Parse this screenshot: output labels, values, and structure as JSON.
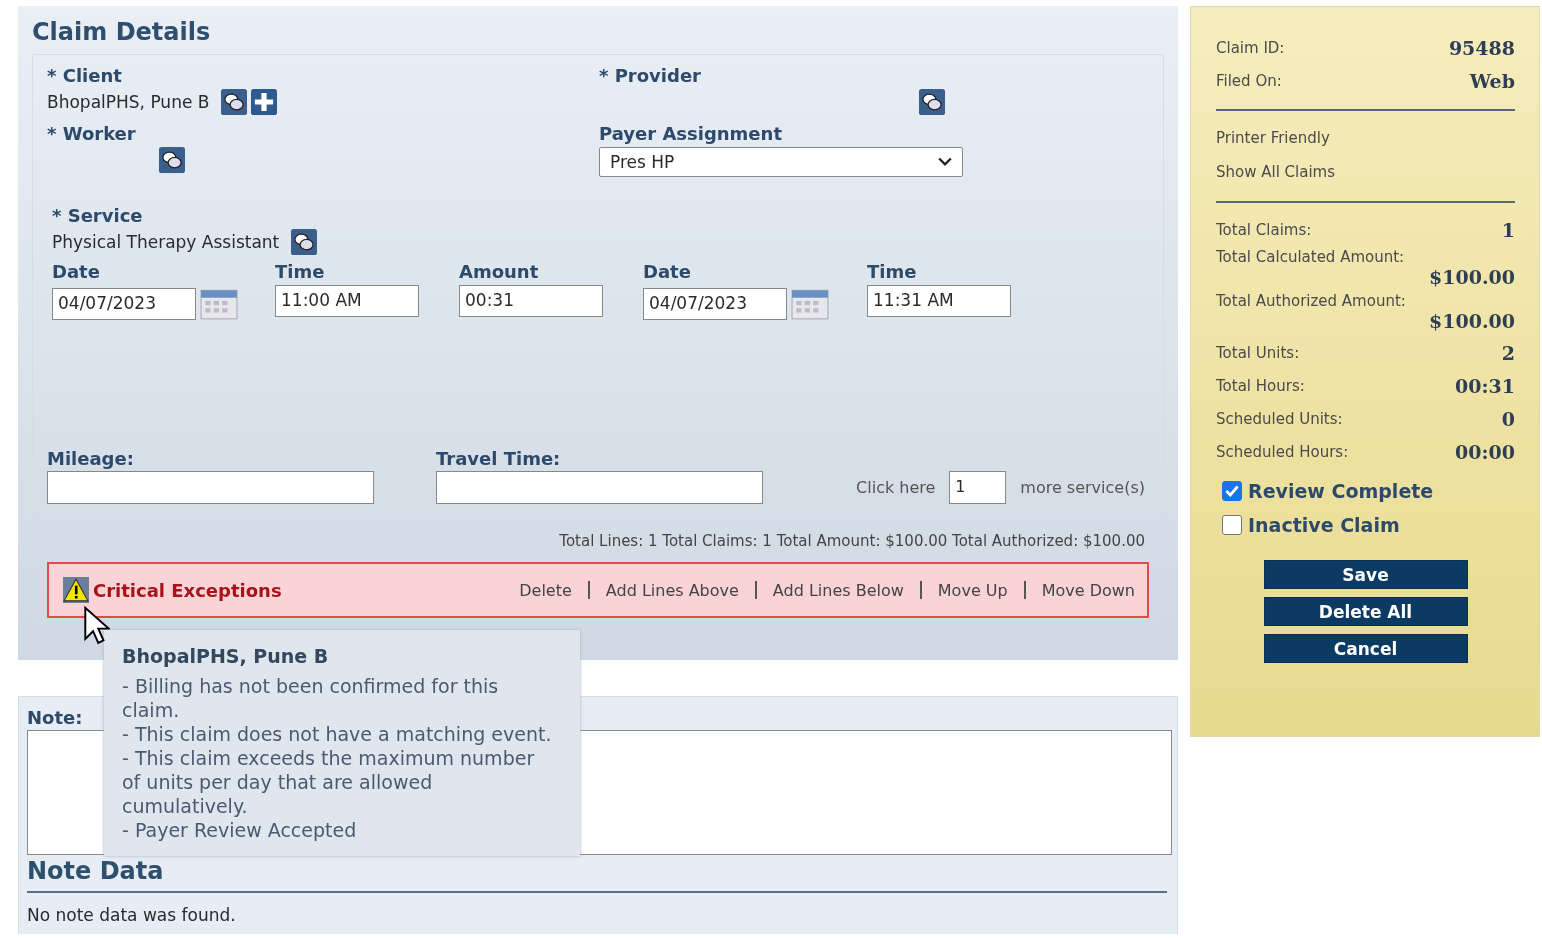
{
  "title": "Claim Details",
  "client": {
    "label": "* Client",
    "value": "BhopalPHS, Pune B"
  },
  "provider": {
    "label": "* Provider"
  },
  "worker": {
    "label": "* Worker"
  },
  "payer_assignment": {
    "label": "Payer Assignment",
    "value": "Pres HP"
  },
  "service": {
    "label": "* Service",
    "value": "Physical Therapy Assistant"
  },
  "time_fields": [
    {
      "label": "Date",
      "value": "04/07/2023",
      "kind": "date"
    },
    {
      "label": "Time",
      "value": "11:00 AM",
      "kind": "text"
    },
    {
      "label": "Amount",
      "value": "00:31",
      "kind": "text"
    },
    {
      "label": "Date",
      "value": "04/07/2023",
      "kind": "date"
    },
    {
      "label": "Time",
      "value": "11:31 AM",
      "kind": "text"
    }
  ],
  "mileage": {
    "label": "Mileage:"
  },
  "travel_time": {
    "label": "Travel Time:"
  },
  "more_services": {
    "prefix": "Click here",
    "value": "1",
    "suffix": "more service(s)"
  },
  "totals": "Total Lines: 1 Total Claims: 1 Total Amount: $100.00 Total Authorized: $100.00",
  "exceptions": {
    "title": "Critical Exceptions",
    "actions": [
      "Delete",
      "Add Lines Above",
      "Add Lines Below",
      "Move Up",
      "Move Down"
    ]
  },
  "tooltip": {
    "title": "BhopalPHS, Pune B",
    "messages": [
      "- Billing has not been confirmed for this claim.",
      "- This claim does not have a matching event.",
      "- This claim exceeds the maximum number of units per day that are allowed cumulatively.",
      "- Payer Review Accepted"
    ]
  },
  "note": {
    "label": "Note:"
  },
  "note_data": {
    "title": "Note Data",
    "message": "No note data was found."
  },
  "sidebar": {
    "info": [
      {
        "label": "Claim ID:",
        "value": "95488"
      },
      {
        "label": "Filed On:",
        "value": "Web"
      }
    ],
    "links": [
      "Printer Friendly",
      "Show All Claims"
    ],
    "stats": [
      {
        "label": "Total Claims:",
        "value": "1",
        "kind": "inline"
      },
      {
        "label": "Total Calculated Amount:",
        "value": "$100.00",
        "kind": "stacked"
      },
      {
        "label": "Total Authorized Amount:",
        "value": "$100.00",
        "kind": "stacked"
      },
      {
        "label": "Total Units:",
        "value": "2",
        "kind": "inline"
      },
      {
        "label": "Total Hours:",
        "value": "00:31",
        "kind": "inline"
      },
      {
        "label": "Scheduled Units:",
        "value": "0",
        "kind": "inline"
      },
      {
        "label": "Scheduled Hours:",
        "value": "00:00",
        "kind": "inline"
      }
    ],
    "checkboxes": [
      {
        "label": "Review Complete",
        "checked": true
      },
      {
        "label": "Inactive Claim",
        "checked": false
      }
    ],
    "buttons": [
      "Save",
      "Delete All",
      "Cancel"
    ]
  }
}
